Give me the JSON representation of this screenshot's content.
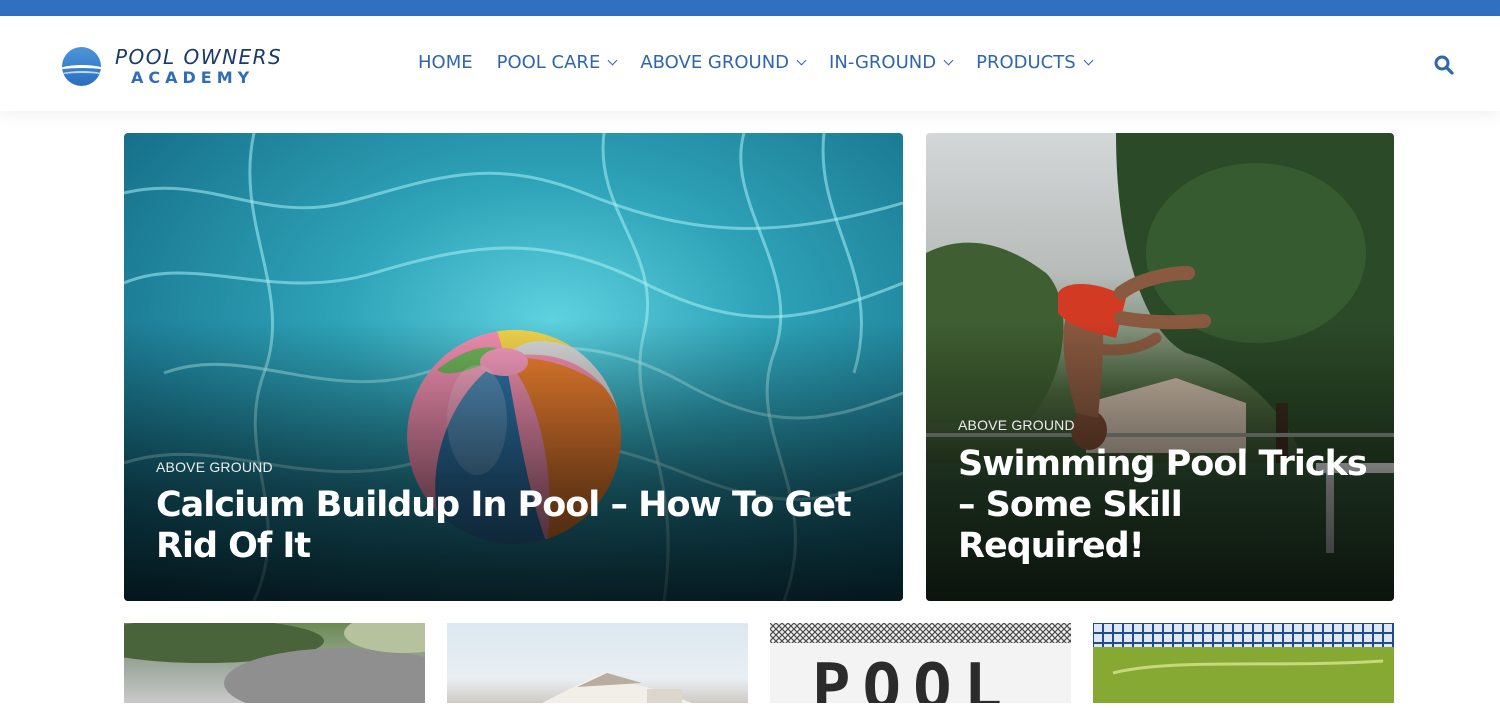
{
  "brand": {
    "name_line1": "POOL OWNERS",
    "name_line2": "ACADEMY",
    "accent": "#3170c0",
    "link_color": "#2f66ae"
  },
  "nav": {
    "items": [
      {
        "label": "HOME",
        "has_dropdown": false
      },
      {
        "label": "POOL CARE",
        "has_dropdown": true
      },
      {
        "label": "ABOVE GROUND",
        "has_dropdown": true
      },
      {
        "label": "IN-GROUND",
        "has_dropdown": true
      },
      {
        "label": "PRODUCTS",
        "has_dropdown": true
      }
    ],
    "search_icon": "search-icon"
  },
  "featured": [
    {
      "category": "ABOVE GROUND",
      "title": "Calcium Buildup In Pool – How To Get Rid Of It",
      "image": "beach-ball-in-pool"
    },
    {
      "category": "ABOVE GROUND",
      "title": "Swimming Pool Tricks – Some Skill Required!",
      "image": "boy-backflip-dive"
    }
  ],
  "grid": [
    {
      "image": "blurred-garden"
    },
    {
      "image": "house-exterior"
    },
    {
      "image": "pool-stencil-sign",
      "sign_text": "POOL"
    },
    {
      "image": "green-algae-pool"
    }
  ]
}
